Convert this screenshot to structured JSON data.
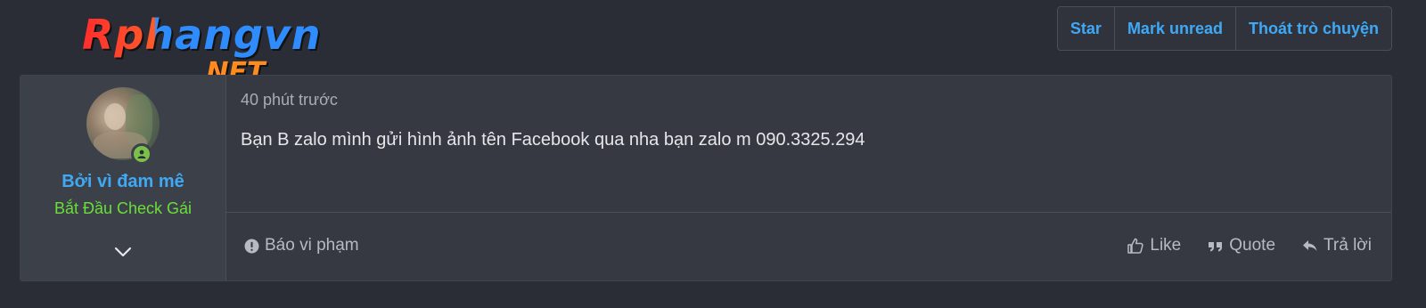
{
  "logo": {
    "main": "Rphangvn",
    "sub": ".NET"
  },
  "topbar": {
    "star": "Star",
    "mark_unread": "Mark unread",
    "leave": "Thoát trò chuyện"
  },
  "post": {
    "user": {
      "name": "Bởi vì đam mê",
      "title": "Bắt Đầu Check Gái"
    },
    "time": "40 phút trước",
    "message": "Bạn B zalo mình gửi hình ảnh tên Facebook qua nha bạn zalo m 090.3325.294",
    "actions": {
      "report": "Báo vi phạm",
      "like": "Like",
      "quote": "Quote",
      "reply": "Trả lời"
    }
  },
  "colors": {
    "accent": "#3fa9f5",
    "title_green": "#6bde3a",
    "online": "#7ac04a"
  }
}
